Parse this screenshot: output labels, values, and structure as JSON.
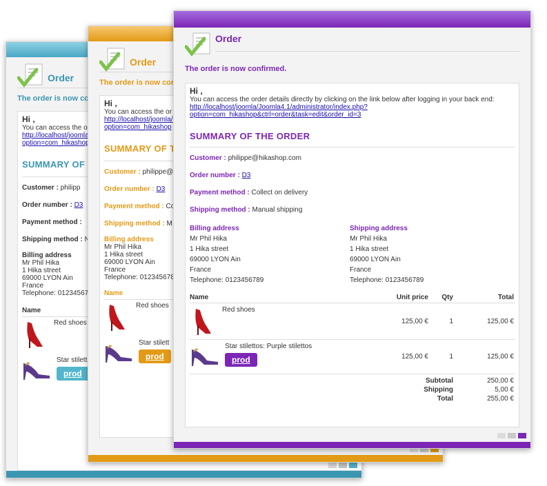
{
  "colors": {
    "teal": "#3a96b1",
    "orange": "#e39a16",
    "purple": "#7c26b6"
  },
  "icons": {
    "order": "checklist-icon",
    "product1": "red-shoe-icon",
    "product2": "purple-stiletto-icon"
  },
  "order": {
    "title": "Order",
    "confirmed": "The order is now confirmed.",
    "greeting": "Hi ,",
    "intro": "You can access the order details directly by clicking on the link below after logging in your back end:",
    "link_line1": "http://localhost/joomla/Joomla4.1/administrator/index.php?",
    "link_line2": "option=com_hikashop&ctrl=order&task=edit&order_id=3",
    "summary_title": "SUMMARY OF THE ORDER",
    "customer_label": "Customer :",
    "customer_value": "philippe@hikashop.com",
    "order_number_label": "Order number :",
    "order_number_value": "D3",
    "payment_label": "Payment method :",
    "payment_value": "Collect on delivery",
    "shipping_label": "Shipping method :",
    "shipping_value": "Manual shipping",
    "billing_title": "Billing address",
    "shipping_title": "Shipping address",
    "address": {
      "name": "Mr Phil Hika",
      "street": "1 Hika street",
      "city": "69000 LYON Ain",
      "country": "France",
      "phone": "Telephone: 0123456789"
    },
    "columns": {
      "name": "Name",
      "unit_price": "Unit price",
      "qty": "Qty",
      "total": "Total"
    },
    "items": [
      {
        "name": "Red shoes",
        "unit_price": "125,00 €",
        "qty": "1",
        "total": "125,00 €"
      },
      {
        "name": "Star stilettos: Purple stilettos",
        "unit_price": "125,00 €",
        "qty": "1",
        "total": "125,00 €",
        "button": "prod"
      }
    ],
    "subtotal_label": "Subtotal",
    "subtotal_value": "250,00 €",
    "shipping_cost_label": "Shipping",
    "shipping_cost_value": "5,00 €",
    "total_label": "Total",
    "total_value": "255,00 €"
  },
  "back_cards": {
    "teal": {
      "confirmed": "The order is now confirm",
      "intro": "You can access the o",
      "link1": "http://localhost/joomla",
      "link2": "option=com_hikashop",
      "summary": "SUMMARY OF",
      "customer": "philipp",
      "order_number": "D3",
      "payment": "",
      "shipping": "N",
      "phone": "Telephone: 01234567",
      "item1": "Red shoes",
      "item2": "Star stiletto",
      "button": "prod"
    },
    "orange": {
      "confirmed": "The order is now conf",
      "intro": "You can access the or",
      "link1": "http://localhost/joomla/",
      "link2": "option=com_hikashop",
      "summary": "SUMMARY OF T",
      "customer": "philippe@",
      "order_number": "D3",
      "payment": "Co",
      "shipping": "M",
      "phone": "Telephone: 012345678",
      "item1": "Red shoes",
      "item2": "Star stilett",
      "button": "prod"
    }
  }
}
